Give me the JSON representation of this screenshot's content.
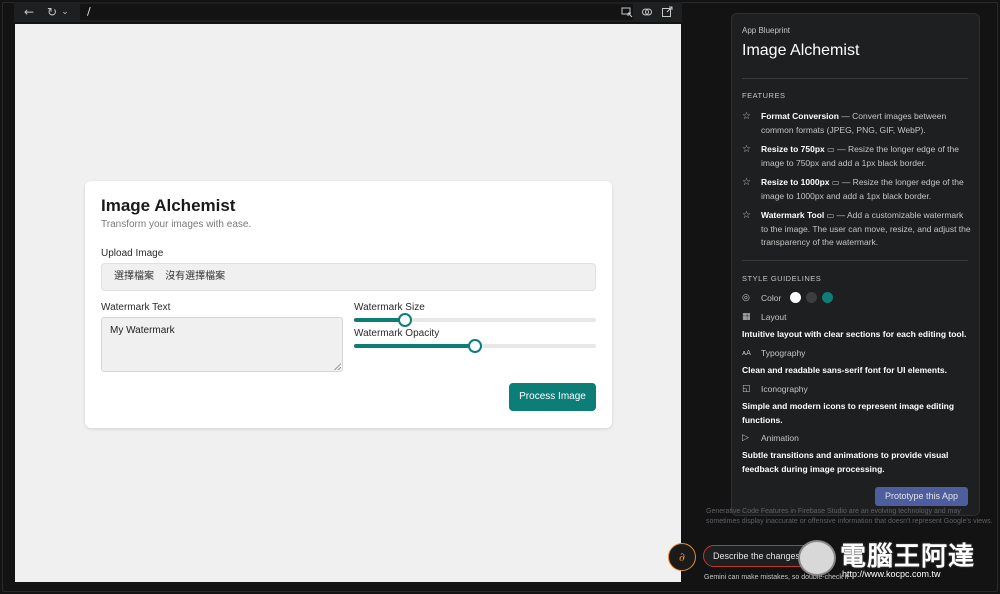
{
  "browser": {
    "url": "/",
    "back_icon": "←",
    "reload_icon": "↻",
    "chevron_icon": "⌄"
  },
  "app": {
    "title": "Image Alchemist",
    "subtitle": "Transform your images with ease.",
    "upload_label": "Upload Image",
    "file_button": "選擇檔案",
    "file_status": "沒有選擇檔案",
    "watermark_text_label": "Watermark Text",
    "watermark_text_value": "My Watermark",
    "watermark_size_label": "Watermark Size",
    "watermark_size_level": 0.21,
    "watermark_opacity_label": "Watermark Opacity",
    "watermark_opacity_level": 0.5,
    "process_button": "Process Image",
    "accent_color": "#0d7d78"
  },
  "blueprint": {
    "label": "App Blueprint",
    "title": "Image Alchemist",
    "features_heading": "FEATURES",
    "features": [
      {
        "name": "Format Conversion",
        "desc": " — Convert images between common formats (JPEG, PNG, GIF, WebP)."
      },
      {
        "name": "Resize to 750px",
        "desc": " — Resize the longer edge of the image to 750px and add a 1px black border."
      },
      {
        "name": "Resize to 1000px",
        "desc": " — Resize the longer edge of the image to 1000px and add a 1px black border."
      },
      {
        "name": "Watermark Tool",
        "desc": " — Add a customizable watermark to the image. The user can move, resize, and adjust the transparency of the watermark."
      }
    ],
    "style_heading": "STYLE GUIDELINES",
    "color_label": "Color",
    "swatches": [
      "#ffffff",
      "#3c3d3f",
      "#0d7d78"
    ],
    "layout_label": "Layout",
    "layout_desc": "Intuitive layout with clear sections for each editing tool.",
    "typography_label": "Typography",
    "typography_desc": "Clean and readable sans-serif font for UI elements.",
    "iconography_label": "Iconography",
    "iconography_desc": "Simple and modern icons to represent image editing functions.",
    "animation_label": "Animation",
    "animation_desc": "Subtle transitions and animations to provide visual feedback during image processing.",
    "prototype_button": "Prototype this App"
  },
  "assistant": {
    "disclaimer": "Generative Code Features in Firebase Studio are an evolving technology and may sometimes display inaccurate or offensive information that doesn't represent Google's views.",
    "input_placeholder": "Describe the changes you want to make",
    "note": "Gemini can make mistakes, so double-check it"
  },
  "watermark": {
    "brand": "電腦王阿達",
    "url": "http://www.kocpc.com.tw"
  }
}
